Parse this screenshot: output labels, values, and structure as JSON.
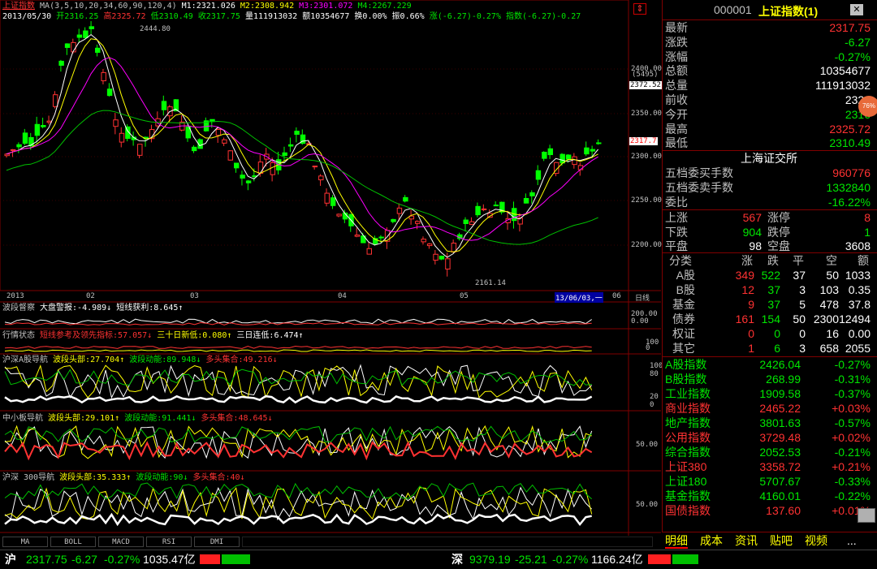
{
  "header": {
    "index_name": "上证指数",
    "ma_label": "MA(3,5,10,20,34,60,90,120,4)",
    "m1": "M1:2321.026",
    "m2": "M2:2308.942",
    "m3": "M3:2301.072",
    "m4": "M4:2267.229",
    "date": "2013/05/30",
    "open": "开2316.25",
    "high": "高2325.72",
    "low": "低2310.49",
    "close": "收2317.75",
    "volume": "量111913032",
    "amount": "额10354677",
    "turnover": "换0.00%",
    "amplitude": "振0.66%",
    "change": "涨(-6.27)-0.27%",
    "index_change": "指数(-6.27)-0.27"
  },
  "main_chart": {
    "high_label": "2444.80",
    "low_label": "2161.14",
    "y_ticks": [
      "2400.00",
      "2350.00",
      "2300.00",
      "2250.00",
      "2200.00"
    ],
    "current_price_tag": "2317.7",
    "crosshair_tag": "2372.52",
    "crosshair_sub": "(5495)",
    "x_ticks": [
      "2013",
      "02",
      "03",
      "04",
      "05"
    ],
    "cursor_date": "13/06/03,一",
    "cursor_tail": "06",
    "period": "日线"
  },
  "panels": [
    {
      "name": "波段督察",
      "items": [
        {
          "t": "大盘警报:-4.989↓",
          "c": "white"
        },
        {
          "t": "短线获利:8.645↑",
          "c": "white"
        }
      ],
      "ticks": [
        "200.00",
        "0.00"
      ]
    },
    {
      "name": "行情状态",
      "items": [
        {
          "t": "短线参考及领先指标:57.057↓",
          "c": "red"
        },
        {
          "t": "三十日新低:0.080↑",
          "c": "yellow"
        },
        {
          "t": "三日连低:6.474↑",
          "c": "white"
        }
      ],
      "ticks": [
        "100",
        "0"
      ]
    },
    {
      "name": "沪深A股导航",
      "items": [
        {
          "t": "波段头部:27.704↑",
          "c": "yellow"
        },
        {
          "t": "波段动能:89.948↓",
          "c": "green"
        },
        {
          "t": "多头集合:49.216↓",
          "c": "red"
        }
      ],
      "ticks": [
        "100",
        "80",
        "20",
        "0"
      ]
    },
    {
      "name": "中小板导航",
      "items": [
        {
          "t": "波段头部:29.101↑",
          "c": "yellow"
        },
        {
          "t": "波段动能:91.441↓",
          "c": "green"
        },
        {
          "t": "多头集合:48.645↓",
          "c": "red"
        }
      ],
      "ticks": [
        "50.00"
      ]
    },
    {
      "name": "沪深 300导航",
      "items": [
        {
          "t": "波段头部:35.333↑",
          "c": "yellow"
        },
        {
          "t": "波段动能:90↓",
          "c": "green"
        },
        {
          "t": "多头集合:40↓",
          "c": "red"
        }
      ],
      "ticks": [
        "50.00"
      ]
    }
  ],
  "indicator_tabs": [
    "MA",
    "BOLL",
    "MACD",
    "RSI",
    "DMI"
  ],
  "quote": {
    "code": "000001",
    "name": "上证指数(1)",
    "rows": [
      {
        "label": "最新",
        "value": "2317.75",
        "color": "red"
      },
      {
        "label": "涨跌",
        "value": "-6.27",
        "color": "green"
      },
      {
        "label": "涨幅",
        "value": "-0.27%",
        "color": "green"
      },
      {
        "label": "总额",
        "value": "10354677",
        "color": "white"
      },
      {
        "label": "总量",
        "value": "111913032",
        "color": "white"
      },
      {
        "label": "前收",
        "value": "2324",
        "color": "white"
      },
      {
        "label": "今开",
        "value": "2316",
        "color": "green"
      },
      {
        "label": "最高",
        "value": "2325.72",
        "color": "red"
      },
      {
        "label": "最低",
        "value": "2310.49",
        "color": "green"
      }
    ],
    "badge": "76%",
    "exchange": "上海证交所",
    "buy_label": "五档委买手数",
    "buy_value": "960776",
    "sell_label": "五档委卖手数",
    "sell_value": "1332840",
    "ratio_label": "委比",
    "ratio_value": "-16.22%",
    "stats": [
      {
        "l1": "上涨",
        "v1": "567",
        "l2": "涨停",
        "v2": "8"
      },
      {
        "l1": "下跌",
        "v1": "904",
        "l2": "跌停",
        "v2": "1"
      },
      {
        "l1": "平盘",
        "v1": "98",
        "l2": "空盘",
        "v2": "3608"
      }
    ],
    "table_headers": [
      "分类",
      "涨",
      "跌",
      "平",
      "空",
      "额"
    ],
    "table_rows": [
      [
        "A股",
        "349",
        "522",
        "37",
        "50",
        "1033"
      ],
      [
        "B股",
        "12",
        "37",
        "3",
        "103",
        "0.35"
      ],
      [
        "基金",
        "9",
        "37",
        "5",
        "478",
        "37.8"
      ],
      [
        "债券",
        "161",
        "154",
        "50",
        "2300",
        "12494"
      ],
      [
        "权证",
        "0",
        "0",
        "0",
        "16",
        "0.00"
      ],
      [
        "其它",
        "1",
        "6",
        "3",
        "658",
        "2055"
      ]
    ],
    "indices": [
      {
        "name": "A股指数",
        "value": "2426.04",
        "pct": "-0.27%",
        "up": false
      },
      {
        "name": "B股指数",
        "value": "268.99",
        "pct": "-0.31%",
        "up": false
      },
      {
        "name": "工业指数",
        "value": "1909.58",
        "pct": "-0.37%",
        "up": false
      },
      {
        "name": "商业指数",
        "value": "2465.22",
        "pct": "+0.03%",
        "up": true
      },
      {
        "name": "地产指数",
        "value": "3801.63",
        "pct": "-0.57%",
        "up": false
      },
      {
        "name": "公用指数",
        "value": "3729.48",
        "pct": "+0.02%",
        "up": true
      },
      {
        "name": "综合指数",
        "value": "2052.53",
        "pct": "-0.21%",
        "up": false
      },
      {
        "name": "上证380",
        "value": "3358.72",
        "pct": "+0.21%",
        "up": true
      },
      {
        "name": "上证180",
        "value": "5707.67",
        "pct": "-0.33%",
        "up": false
      },
      {
        "name": "基金指数",
        "value": "4160.01",
        "pct": "-0.22%",
        "up": false
      },
      {
        "name": "国债指数",
        "value": "137.60",
        "pct": "+0.01%",
        "up": true
      }
    ],
    "bottom_tabs": [
      "明细",
      "成本",
      "资讯",
      "贴吧",
      "视频",
      "..."
    ]
  },
  "status": {
    "sh_label": "沪",
    "sh_value": "2317.75",
    "sh_change": "-6.27",
    "sh_pct": "-0.27%",
    "sh_amount": "1035.47亿",
    "sz_label": "深",
    "sz_value": "9379.19",
    "sz_change": "-25.21",
    "sz_pct": "-0.27%",
    "sz_amount": "1166.24亿"
  },
  "colors": {
    "up": "#ff3232",
    "down": "#00e600",
    "grid": "#800000",
    "label": "#c0c0c0"
  }
}
